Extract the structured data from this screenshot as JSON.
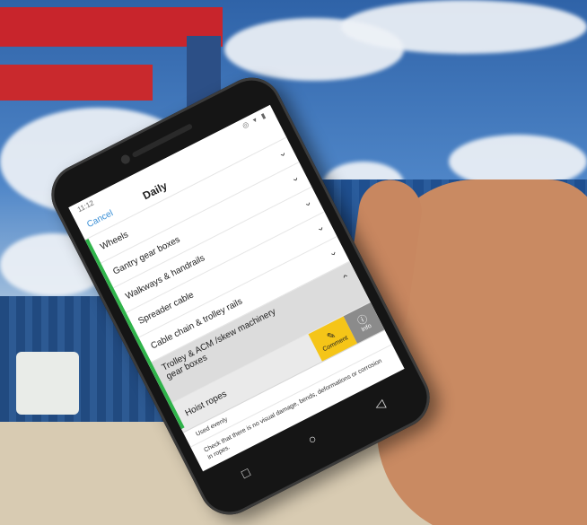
{
  "status_bar": {
    "time": "11:12",
    "icons": "◎ ▾ ▮"
  },
  "header": {
    "cancel_label": "Cancel",
    "title": "Daily"
  },
  "items": [
    {
      "label": "Wheels"
    },
    {
      "label": "Gantry gear boxes"
    },
    {
      "label": "Walkways & handrails"
    },
    {
      "label": "Spreader cable"
    },
    {
      "label": "Cable chain & trolley rails"
    },
    {
      "label": "Trolley & ACM /skew machinery gear boxes"
    }
  ],
  "icons": {
    "chevron_down": "›",
    "comment_icon": "✎",
    "info_icon": "ⓘ"
  },
  "hoist_ropes": {
    "label": "Hoist ropes",
    "comment_label": "Comment",
    "info_label": "Info",
    "subline": "Used evenly",
    "description": "Check that there is no visual damage, bends, deformations or corrosion in ropes."
  },
  "nav": {
    "back": "◁",
    "home": "○",
    "recents": "□"
  },
  "colors": {
    "accent_green": "#2fb34a",
    "comment_yellow": "#f5c518",
    "link_blue": "#3a8fd6",
    "info_gray": "#8b8b8b"
  }
}
